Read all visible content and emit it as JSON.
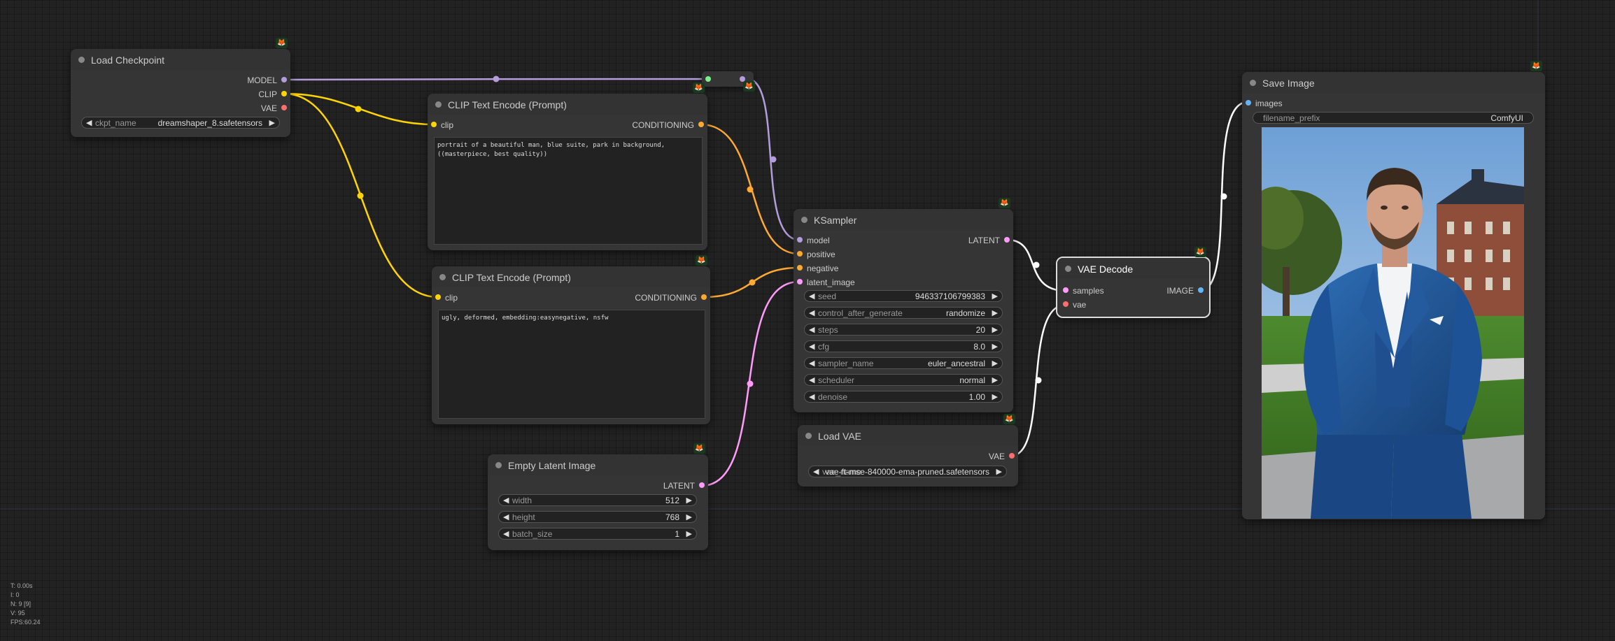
{
  "colors": {
    "model": "#b39ddb",
    "clip": "#ffd500",
    "vae": "#ff6e6e",
    "conditioning": "#ffa931",
    "latent": "#ff9cf9",
    "image": "#64b5f6",
    "white_link": "#ffffff"
  },
  "nodes": {
    "load_checkpoint": {
      "title": "Load Checkpoint",
      "outputs": [
        "MODEL",
        "CLIP",
        "VAE"
      ],
      "widget": {
        "label": "ckpt_name",
        "value": "dreamshaper_8.safetensors"
      }
    },
    "clip_pos": {
      "title": "CLIP Text Encode (Prompt)",
      "input": "clip",
      "output": "CONDITIONING",
      "text": "portrait of a beautiful man, blue suite, park in background, ((masterpiece, best quality))"
    },
    "clip_neg": {
      "title": "CLIP Text Encode (Prompt)",
      "input": "clip",
      "output": "CONDITIONING",
      "text": "ugly, deformed, embedding:easynegative, nsfw"
    },
    "ksampler": {
      "title": "KSampler",
      "inputs": [
        "model",
        "positive",
        "negative",
        "latent_image"
      ],
      "output": "LATENT",
      "widgets": [
        {
          "label": "seed",
          "value": "946337106799383"
        },
        {
          "label": "control_after_generate",
          "value": "randomize"
        },
        {
          "label": "steps",
          "value": "20"
        },
        {
          "label": "cfg",
          "value": "8.0"
        },
        {
          "label": "sampler_name",
          "value": "euler_ancestral"
        },
        {
          "label": "scheduler",
          "value": "normal"
        },
        {
          "label": "denoise",
          "value": "1.00"
        }
      ]
    },
    "empty_latent": {
      "title": "Empty Latent Image",
      "output": "LATENT",
      "widgets": [
        {
          "label": "width",
          "value": "512"
        },
        {
          "label": "height",
          "value": "768"
        },
        {
          "label": "batch_size",
          "value": "1"
        }
      ]
    },
    "load_vae": {
      "title": "Load VAE",
      "output": "VAE",
      "widget": {
        "label": "vae_name",
        "value": "vae-ft-mse-840000-ema-pruned.safetensors"
      }
    },
    "vae_decode": {
      "title": "VAE Decode",
      "inputs": [
        "samples",
        "vae"
      ],
      "output": "IMAGE"
    },
    "save_image": {
      "title": "Save Image",
      "input": "images",
      "widget": {
        "label": "filename_prefix",
        "value": "ComfyUI"
      }
    }
  },
  "badge_icon": "fox-badge-icon",
  "stats": [
    "T: 0.00s",
    "I: 0",
    "N: 9 [9]",
    "V: 95",
    "FPS:60.24"
  ]
}
